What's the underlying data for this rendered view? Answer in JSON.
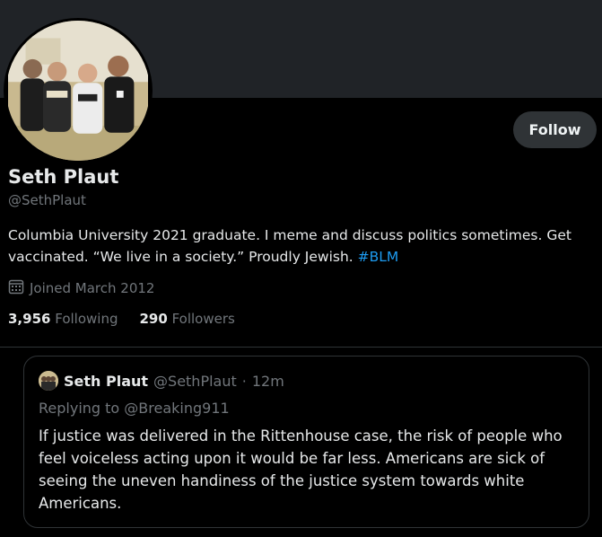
{
  "profile": {
    "name": "Seth Plaut",
    "handle": "@SethPlaut",
    "follow_label": "Follow",
    "bio_text": "Columbia University 2021 graduate. I meme and discuss politics sometimes. Get vaccinated. “We live in a society.” Proudly Jewish. ",
    "bio_hashtag": "#BLM",
    "joined": "Joined March 2012",
    "following_count": "3,956",
    "following_label": "Following",
    "followers_count": "290",
    "followers_label": "Followers"
  },
  "quoted_tweet": {
    "name": "Seth Plaut",
    "handle": "@SethPlaut",
    "separator": "·",
    "time": "12m",
    "replying_to": "Replying to @Breaking911",
    "text": "If justice was delivered in the Rittenhouse case, the risk of people who feel voiceless acting upon it would be far less. Americans are sick of seeing the uneven handiness of the justice system towards white Americans."
  },
  "colors": {
    "background": "#000000",
    "banner": "#202327",
    "text": "#e7e9ea",
    "secondary_text": "#71767b",
    "hashtag": "#1d9bf0",
    "button_bg": "#2f3336"
  },
  "icons": [
    "calendar-icon"
  ]
}
